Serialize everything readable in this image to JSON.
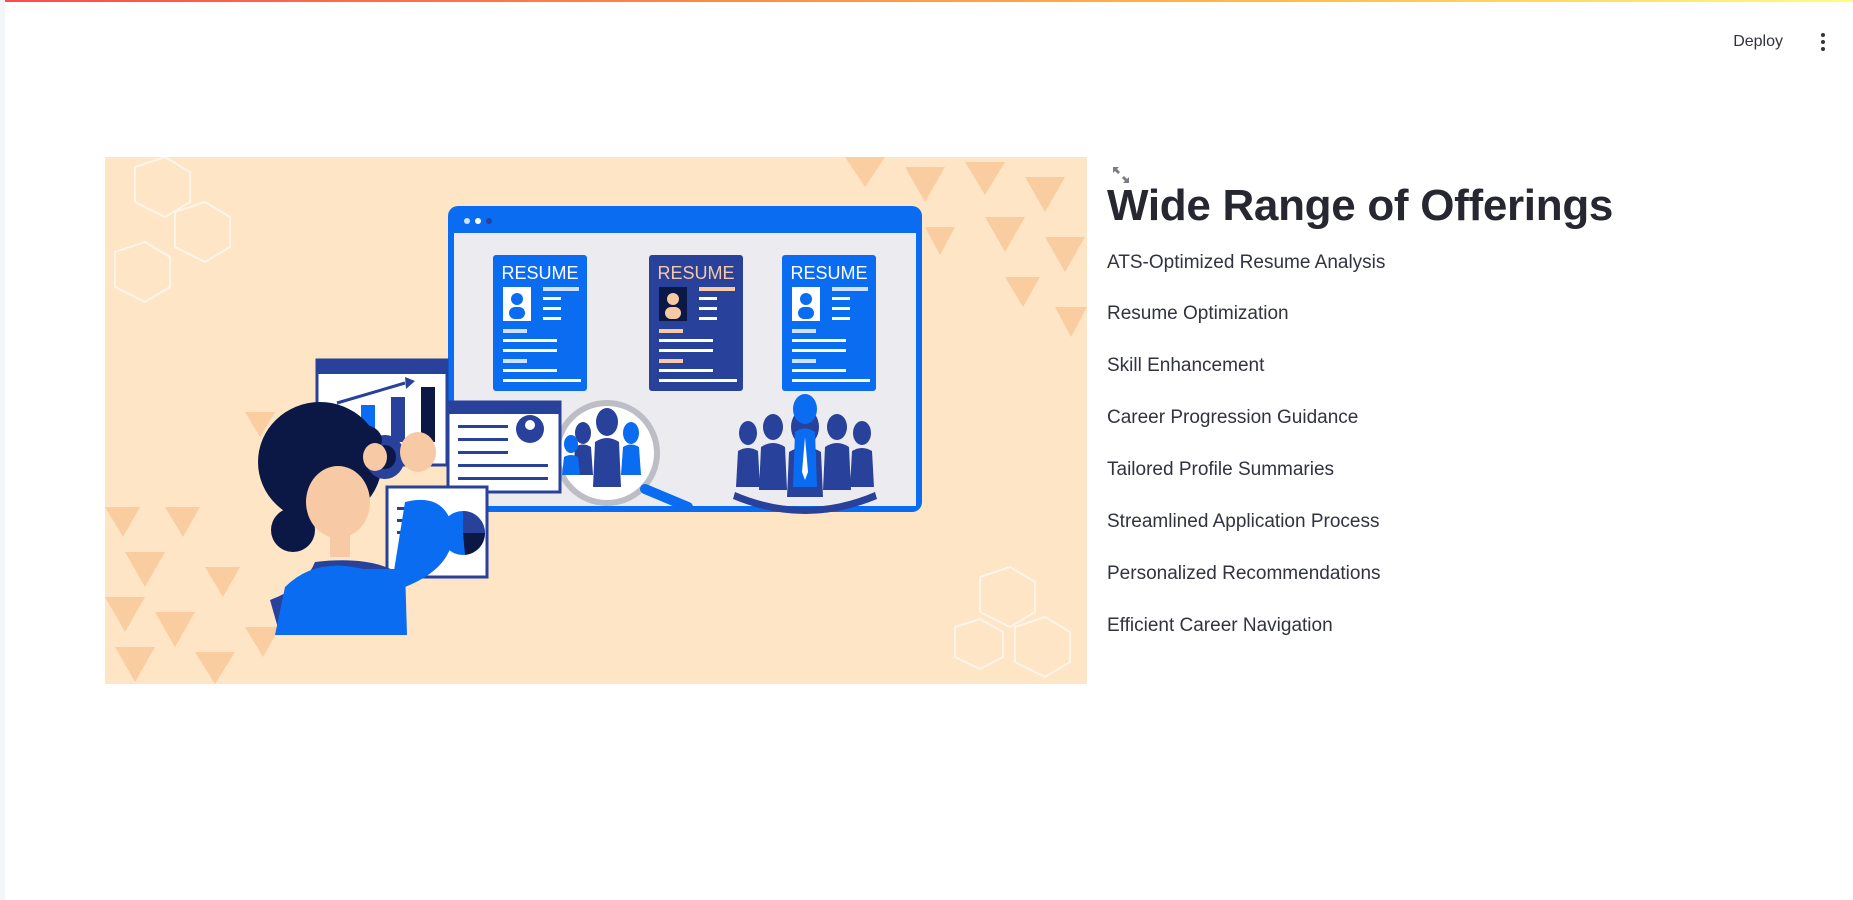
{
  "header": {
    "deploy_label": "Deploy",
    "menu_icon": "kebab-menu-icon"
  },
  "hero": {
    "resume_label": "RESUME",
    "expand_icon": "expand-icon"
  },
  "main": {
    "title": "Wide Range of Offerings",
    "offerings": [
      "ATS-Optimized Resume Analysis",
      "Resume Optimization",
      "Skill Enhancement",
      "Career Progression Guidance",
      "Tailored Profile Summaries",
      "Streamlined Application Process",
      "Personalized Recommendations",
      "Efficient Career Navigation"
    ]
  },
  "colors": {
    "accent_blue": "#0a6cf0",
    "navy": "#28419b",
    "peach_background": "#fde5c6",
    "text": "#31333f"
  }
}
